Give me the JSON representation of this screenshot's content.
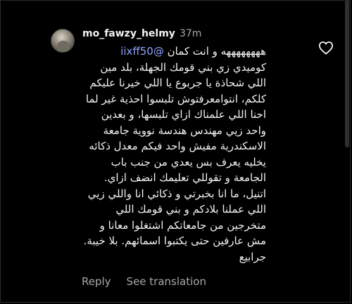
{
  "comment": {
    "username": "mo_fawzy_helmy",
    "time": "37m",
    "mention": "@iixff50",
    "first_line_text": "ههههههههه و انت كمان",
    "body": "كوميدي زي بني قومك الجهلة،  بلد مين اللي شحاذة يا جربوع يا اللي خيرنا عليكم كلكم،  انتوامعرفتوش تلبسوا احذية غير لما احنا اللي علمناك ازاي تلبسها،  و بعدين واحد زيي مهندس هندسة نووية جامعة الاسكندرية مفيش واحد فيكم معدل ذكائه يخليه يعرف بس يعدي من جنب باب الجامعة و تقوللي تعليمك انضف ازاي. اتنيل،  ما انا بخبرتي و ذكائي انا واللي زيي اللي عملنا بلادكم و بني قومك اللي متخرجين من جامعاتكم اشتغلوا معانا و مش عارفين حتى يكتبوا اسمائهم.  بلا خيبة. جرابيع"
  },
  "actions": {
    "reply_label": "Reply",
    "translate_label": "See translation"
  },
  "icons": {
    "like": "heart-outline-icon"
  },
  "colors": {
    "background": "#000000",
    "text": "#f2f2f2",
    "muted": "#a8a8a8",
    "mention": "#8ea4ff"
  }
}
